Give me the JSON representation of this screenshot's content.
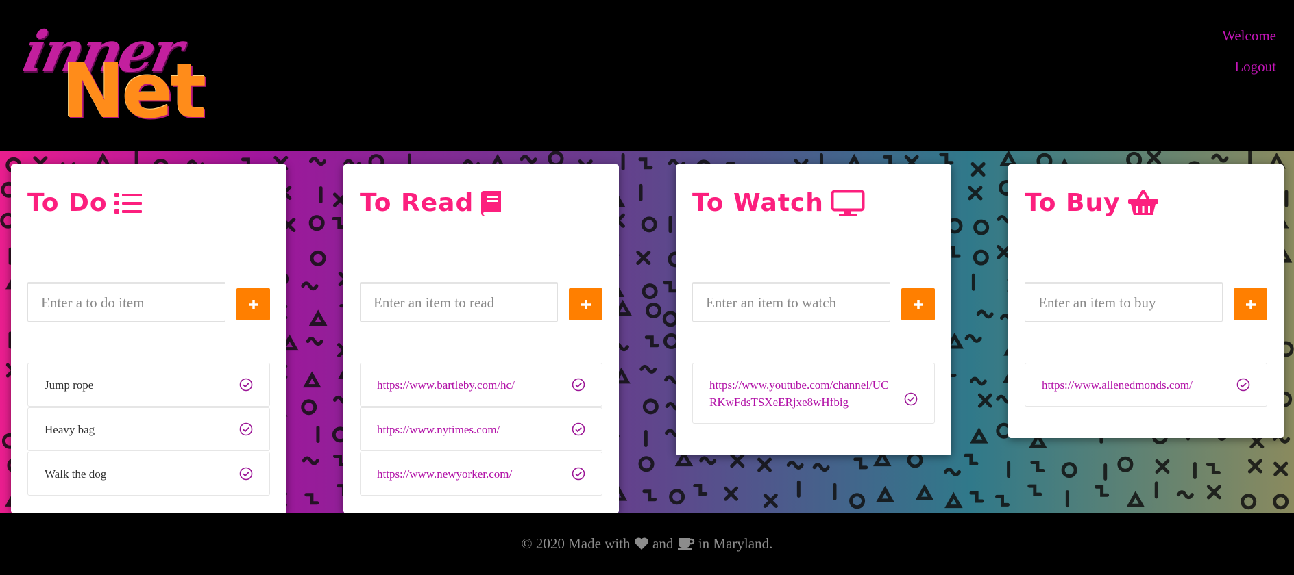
{
  "header": {
    "logo": {
      "word1": "inner",
      "word2": "Net"
    },
    "nav": {
      "welcome": "Welcome",
      "logout": "Logout"
    }
  },
  "cards": [
    {
      "title": "To Do",
      "icon": "list-icon",
      "placeholder": "Enter a to do item",
      "add_label": "+",
      "items": [
        "Jump rope",
        "Heavy bag",
        "Walk the dog"
      ]
    },
    {
      "title": "To Read",
      "icon": "book-icon",
      "placeholder": "Enter an item to read",
      "add_label": "+",
      "items": [
        "https://www.bartleby.com/hc/",
        "https://www.nytimes.com/",
        "https://www.newyorker.com/"
      ]
    },
    {
      "title": "To Watch",
      "icon": "desktop-icon",
      "placeholder": "Enter an item to watch",
      "add_label": "+",
      "items": [
        "https://www.youtube.com/channel/UCRKwFdsTSXeERjxe8wHfbig"
      ]
    },
    {
      "title": "To Buy",
      "icon": "basket-icon",
      "placeholder": "Enter an item to buy",
      "add_label": "+",
      "items": [
        "https://www.allenedmonds.com/"
      ]
    }
  ],
  "footer": {
    "text_before": "© 2020 Made with",
    "text_middle": "and",
    "text_after": "in Maryland."
  },
  "colors": {
    "accent_pink": "#fc1f7e",
    "accent_orange": "#ff7f00",
    "link_purple": "#b211a7",
    "nav_magenta": "#c415b8"
  }
}
